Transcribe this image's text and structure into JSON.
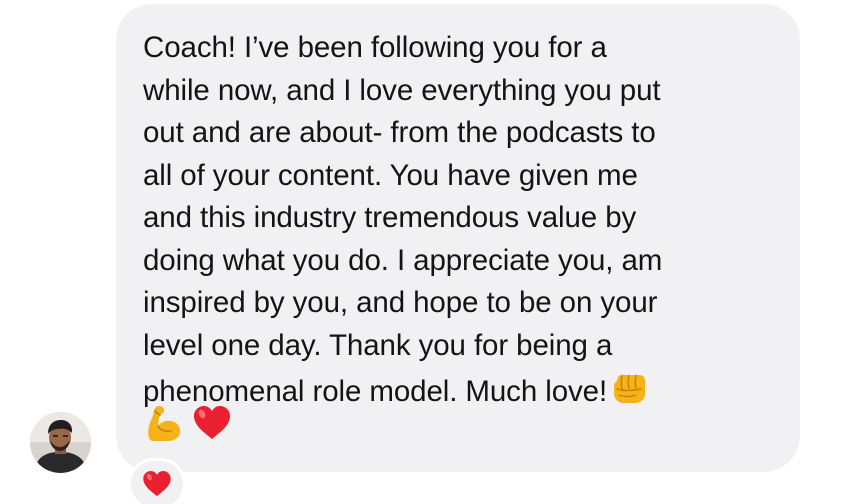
{
  "message": {
    "text": "Coach! I’ve been following you for a\nwhile now, and I love everything you put\nout and are about- from the podcasts to\nall of your content. You have given me\nand this industry tremendous value by\ndoing what you do. I appreciate you, am\ninspired by you, and hope to be on your\nlevel one day. Thank you for being a\nphenomenal role model. Much love!",
    "trailing_emoji": "fist-bump-icon",
    "emojis": [
      "flexed-biceps-icon",
      "red-heart-icon"
    ]
  },
  "sender": {
    "avatar": "avatar"
  },
  "reaction": {
    "emoji": "red-heart-icon"
  },
  "colors": {
    "bubble": "#f1f1f3",
    "text": "#141414",
    "heart": "#e8202f",
    "emoji_yellow": "#f6b319"
  }
}
